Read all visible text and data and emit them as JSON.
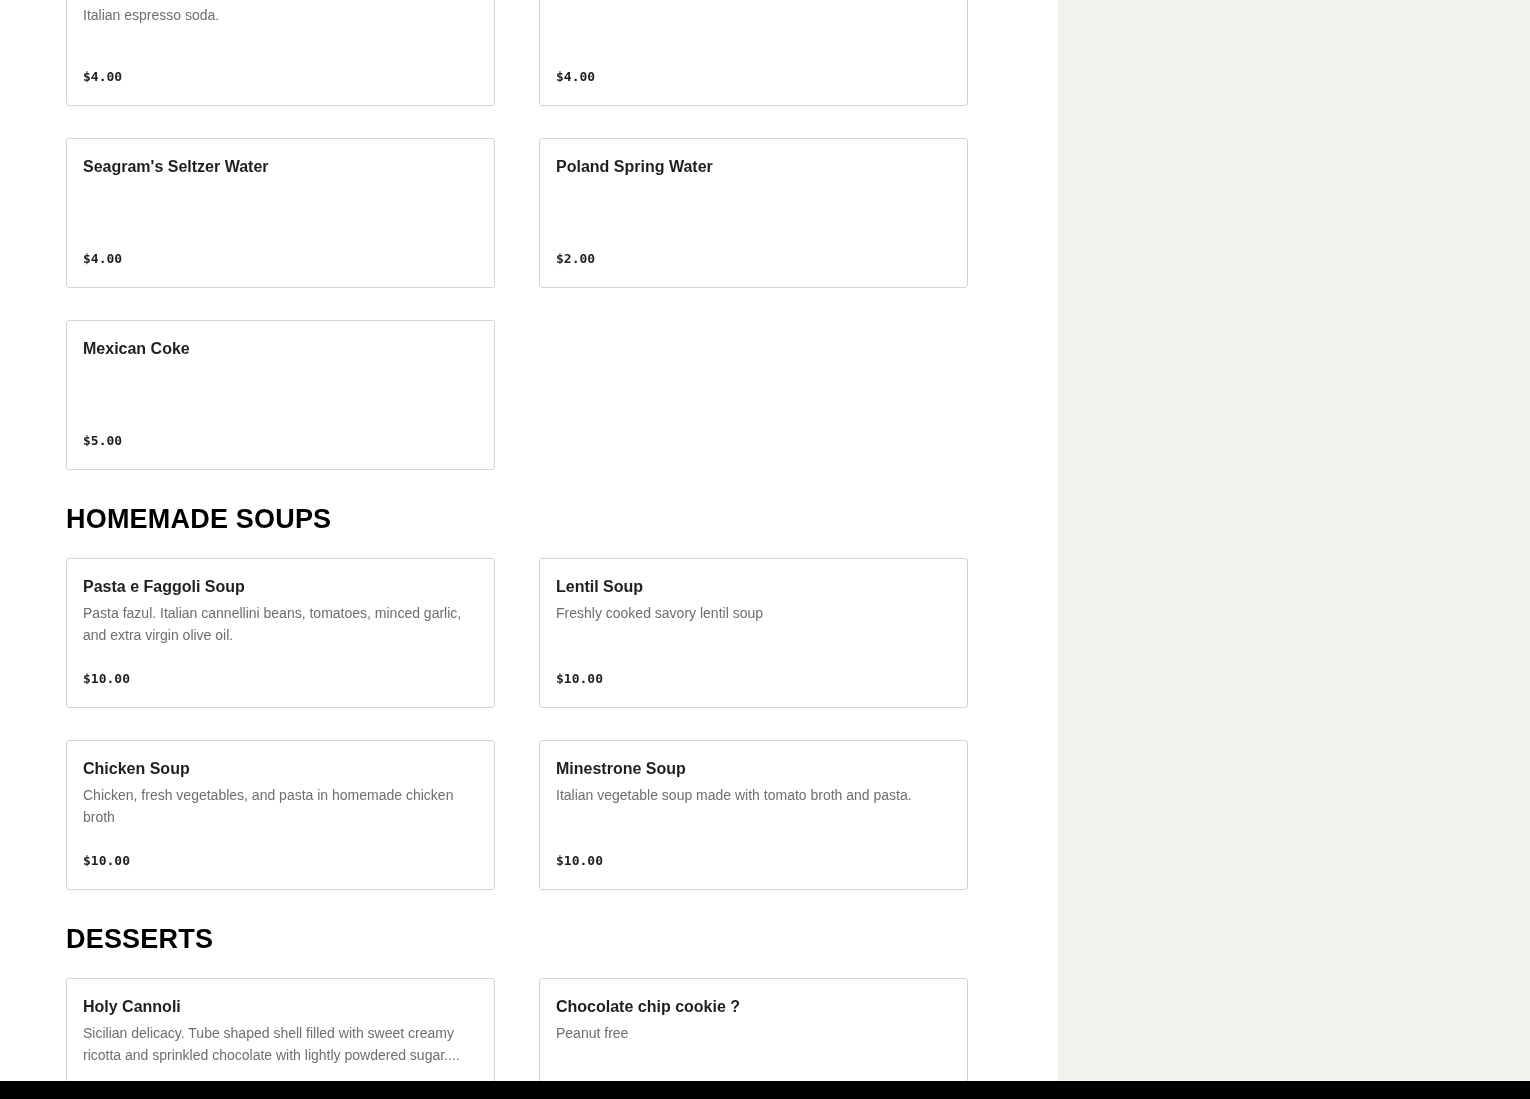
{
  "sections": [
    {
      "items": [
        {
          "description": "Italian espresso soda.",
          "price": "$4.00"
        },
        {
          "price": "$4.00"
        },
        {
          "name": "Seagram's Seltzer Water",
          "price": "$4.00"
        },
        {
          "name": "Poland Spring Water",
          "price": "$2.00"
        },
        {
          "name": "Mexican Coke",
          "price": "$5.00"
        }
      ]
    },
    {
      "heading": "HOMEMADE SOUPS",
      "items": [
        {
          "name": "Pasta e Faggoli Soup",
          "description": "Pasta fazul. Italian cannellini beans, tomatoes, minced garlic, and extra virgin olive oil.",
          "price": "$10.00"
        },
        {
          "name": "Lentil Soup",
          "description": "Freshly cooked savory lentil soup",
          "price": "$10.00"
        },
        {
          "name": "Chicken Soup",
          "description": "Chicken, fresh vegetables, and pasta in homemade chicken broth",
          "price": "$10.00"
        },
        {
          "name": "Minestrone Soup",
          "description": "Italian vegetable soup made with tomato broth and pasta.",
          "price": "$10.00"
        }
      ]
    },
    {
      "heading": "DESSERTS",
      "items": [
        {
          "name": "Holy Cannoli",
          "description": "Sicilian delicacy. Tube shaped shell filled with sweet creamy ricotta and sprinkled chocolate with lightly powdered sugar...."
        },
        {
          "name": "Chocolate chip cookie ?",
          "description": "Peanut free"
        }
      ]
    }
  ]
}
